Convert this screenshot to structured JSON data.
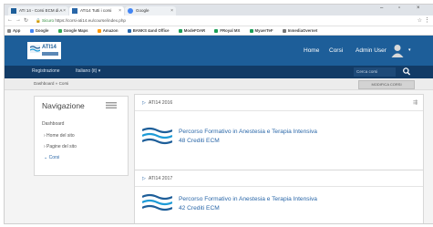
{
  "browser": {
    "tabs": [
      {
        "label": "ATI 14 - Corsi ECM di A"
      },
      {
        "label": "ATI14 Tutti i corsi"
      },
      {
        "label": "Google"
      }
    ],
    "address": {
      "secure_label": "Sicuro",
      "url": "https://corsi-ati14.eu/course/index.php"
    },
    "bookmarks": [
      "App",
      "Google",
      "Google Maps",
      "Amazon",
      "BANKS 4and Office",
      "ModeFOAR",
      "FRoyal MX",
      "MyuerTeF",
      "InmediaOvernet"
    ]
  },
  "header": {
    "logo_text": "ATI14",
    "links": [
      "Home",
      "Corsi",
      "Admin User"
    ]
  },
  "nav2": {
    "items": [
      "Registrazione",
      "Italiano (it) ▾"
    ],
    "search_placeholder": "Cerca corsi"
  },
  "breadcrumb": {
    "text": "Dashboard  »  Corsi",
    "edit_button": "MODIFICA CORSI"
  },
  "navigation_block": {
    "title": "Navigazione",
    "items": [
      "Dashboard",
      "›  Home del sito",
      "›  Pagine del sito",
      "⌄  Corsi"
    ]
  },
  "categories": [
    {
      "name": "ATI14 2016",
      "course_title": "Percorso Formativo in Anestesia e Terapia Intensiva",
      "credits": "48 Crediti ECM"
    },
    {
      "name": "ATI14 2017",
      "course_title": "Percorso Formativo in Anestesia e Terapia Intensiva",
      "credits": "42 Crediti ECM"
    }
  ],
  "colors": {
    "header_blue": "#1d5e99",
    "nav_dark": "#123b66",
    "link_blue": "#2a67a8"
  }
}
